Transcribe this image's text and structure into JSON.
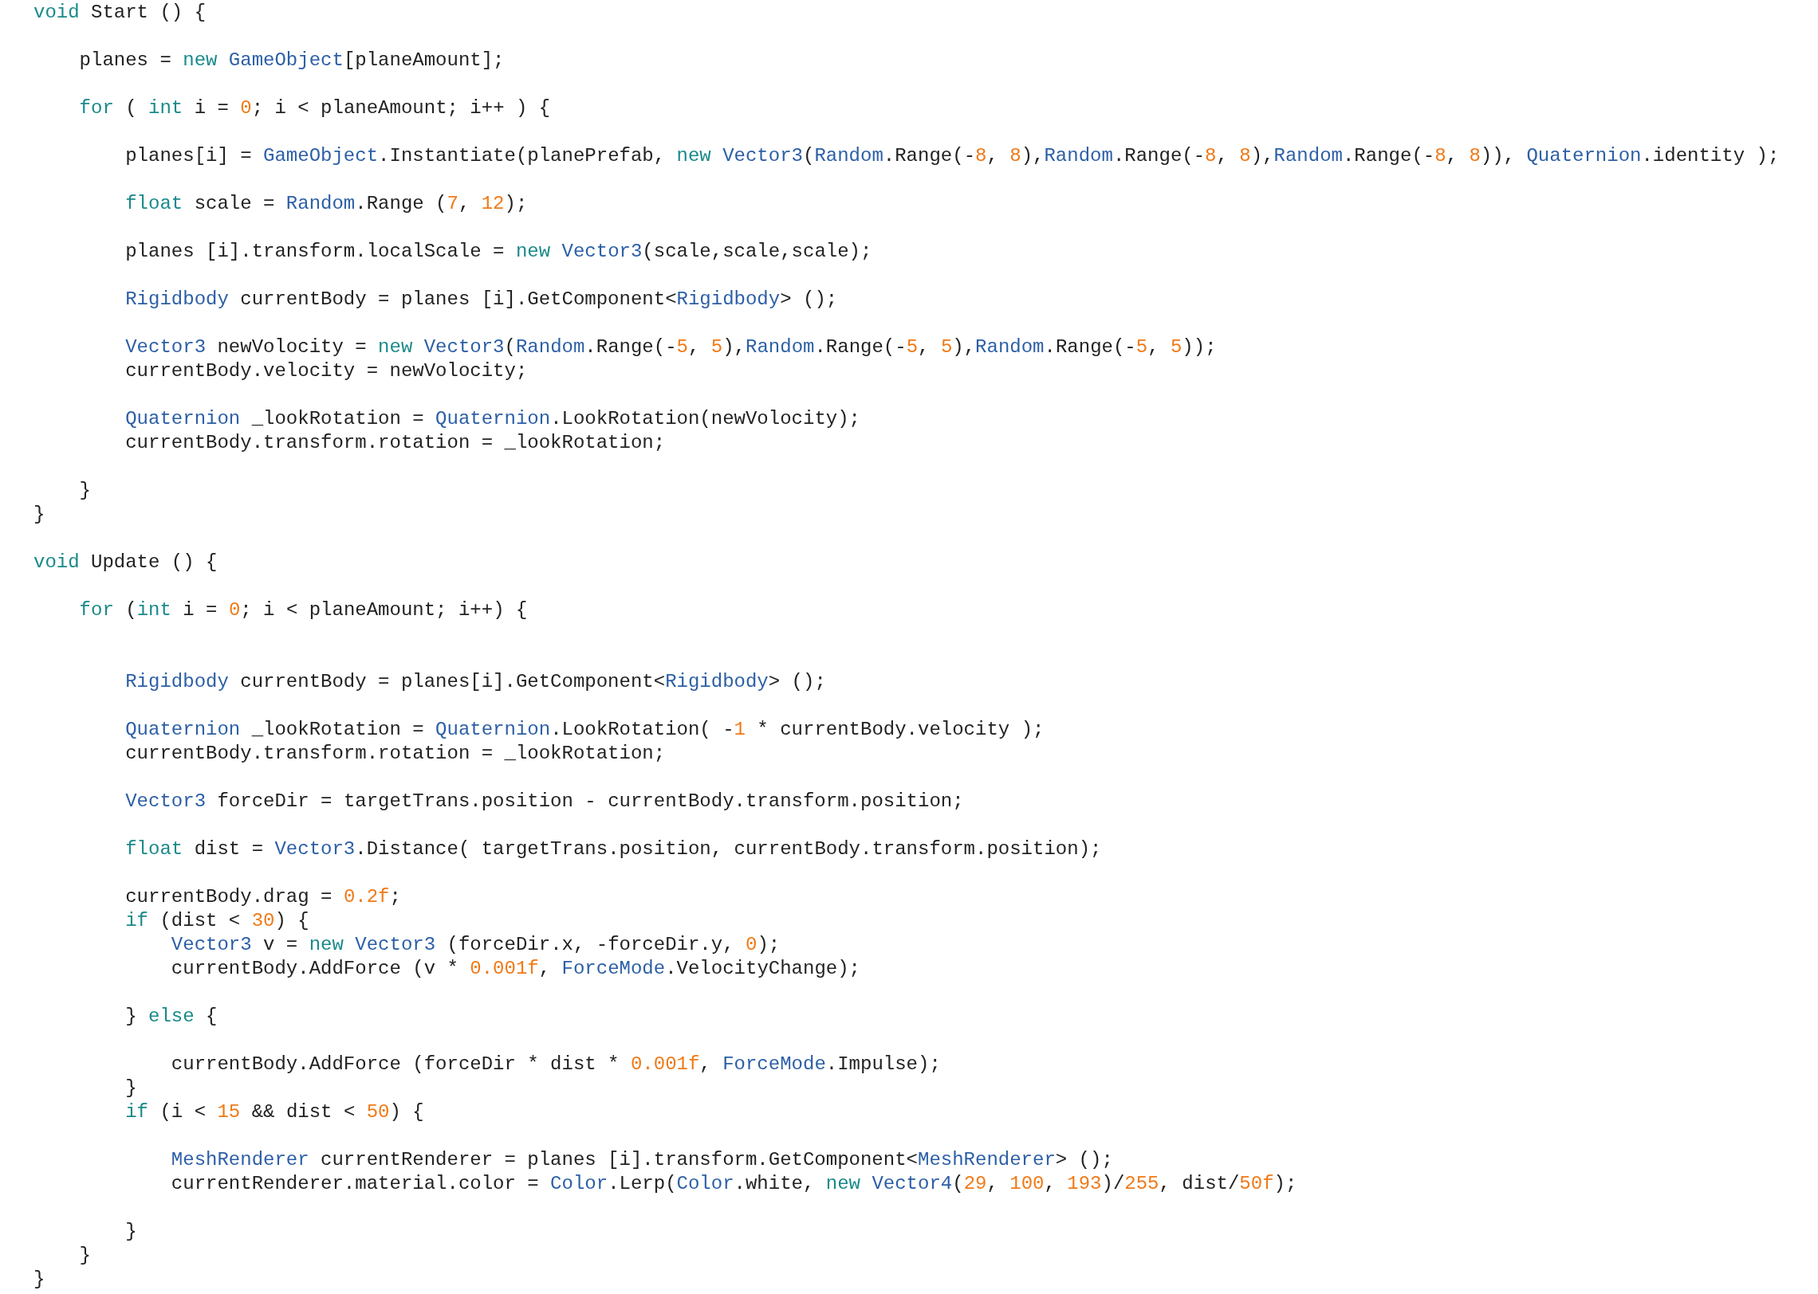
{
  "code_lines": [
    {
      "kind": "code",
      "tokens": [
        {
          "kind": "keyword",
          "text": "void"
        },
        {
          "kind": "plain",
          "text": " Start () {"
        }
      ]
    },
    {
      "kind": "blank"
    },
    {
      "kind": "code",
      "tokens": [
        {
          "kind": "plain",
          "text": "    planes = "
        },
        {
          "kind": "keyword",
          "text": "new "
        },
        {
          "kind": "type",
          "text": "GameObject"
        },
        {
          "kind": "plain",
          "text": "[planeAmount];"
        }
      ]
    },
    {
      "kind": "blank"
    },
    {
      "kind": "code",
      "tokens": [
        {
          "kind": "keyword",
          "text": "    for"
        },
        {
          "kind": "plain",
          "text": " ( "
        },
        {
          "kind": "keyword",
          "text": "int"
        },
        {
          "kind": "plain",
          "text": " i = "
        },
        {
          "kind": "number",
          "text": "0"
        },
        {
          "kind": "plain",
          "text": "; i < planeAmount; i++ ) {"
        }
      ]
    },
    {
      "kind": "blank"
    },
    {
      "kind": "code",
      "tokens": [
        {
          "kind": "plain",
          "text": "        planes[i] = "
        },
        {
          "kind": "type",
          "text": "GameObject"
        },
        {
          "kind": "plain",
          "text": ".Instantiate(planePrefab, "
        },
        {
          "kind": "keyword",
          "text": "new "
        },
        {
          "kind": "type",
          "text": "Vector3"
        },
        {
          "kind": "plain",
          "text": "("
        },
        {
          "kind": "type",
          "text": "Random"
        },
        {
          "kind": "plain",
          "text": ".Range(-"
        },
        {
          "kind": "number",
          "text": "8"
        },
        {
          "kind": "plain",
          "text": ", "
        },
        {
          "kind": "number",
          "text": "8"
        },
        {
          "kind": "plain",
          "text": "),"
        },
        {
          "kind": "type",
          "text": "Random"
        },
        {
          "kind": "plain",
          "text": ".Range(-"
        },
        {
          "kind": "number",
          "text": "8"
        },
        {
          "kind": "plain",
          "text": ", "
        },
        {
          "kind": "number",
          "text": "8"
        },
        {
          "kind": "plain",
          "text": "),"
        },
        {
          "kind": "type",
          "text": "Random"
        },
        {
          "kind": "plain",
          "text": ".Range(-"
        },
        {
          "kind": "number",
          "text": "8"
        },
        {
          "kind": "plain",
          "text": ", "
        },
        {
          "kind": "number",
          "text": "8"
        },
        {
          "kind": "plain",
          "text": ")), "
        },
        {
          "kind": "type",
          "text": "Quaternion"
        },
        {
          "kind": "plain",
          "text": ".identity );"
        }
      ]
    },
    {
      "kind": "blank"
    },
    {
      "kind": "code",
      "tokens": [
        {
          "kind": "keyword",
          "text": "        float"
        },
        {
          "kind": "plain",
          "text": " scale = "
        },
        {
          "kind": "type",
          "text": "Random"
        },
        {
          "kind": "plain",
          "text": ".Range ("
        },
        {
          "kind": "number",
          "text": "7"
        },
        {
          "kind": "plain",
          "text": ", "
        },
        {
          "kind": "number",
          "text": "12"
        },
        {
          "kind": "plain",
          "text": ");"
        }
      ]
    },
    {
      "kind": "blank"
    },
    {
      "kind": "code",
      "tokens": [
        {
          "kind": "plain",
          "text": "        planes [i].transform.localScale = "
        },
        {
          "kind": "keyword",
          "text": "new "
        },
        {
          "kind": "type",
          "text": "Vector3"
        },
        {
          "kind": "plain",
          "text": "(scale,scale,scale);"
        }
      ]
    },
    {
      "kind": "blank"
    },
    {
      "kind": "code",
      "tokens": [
        {
          "kind": "type",
          "text": "        Rigidbody"
        },
        {
          "kind": "plain",
          "text": " currentBody = planes [i].GetComponent<"
        },
        {
          "kind": "type",
          "text": "Rigidbody"
        },
        {
          "kind": "plain",
          "text": "> ();"
        }
      ]
    },
    {
      "kind": "blank"
    },
    {
      "kind": "code",
      "tokens": [
        {
          "kind": "type",
          "text": "        Vector3"
        },
        {
          "kind": "plain",
          "text": " newVolocity = "
        },
        {
          "kind": "keyword",
          "text": "new "
        },
        {
          "kind": "type",
          "text": "Vector3"
        },
        {
          "kind": "plain",
          "text": "("
        },
        {
          "kind": "type",
          "text": "Random"
        },
        {
          "kind": "plain",
          "text": ".Range(-"
        },
        {
          "kind": "number",
          "text": "5"
        },
        {
          "kind": "plain",
          "text": ", "
        },
        {
          "kind": "number",
          "text": "5"
        },
        {
          "kind": "plain",
          "text": "),"
        },
        {
          "kind": "type",
          "text": "Random"
        },
        {
          "kind": "plain",
          "text": ".Range(-"
        },
        {
          "kind": "number",
          "text": "5"
        },
        {
          "kind": "plain",
          "text": ", "
        },
        {
          "kind": "number",
          "text": "5"
        },
        {
          "kind": "plain",
          "text": "),"
        },
        {
          "kind": "type",
          "text": "Random"
        },
        {
          "kind": "plain",
          "text": ".Range(-"
        },
        {
          "kind": "number",
          "text": "5"
        },
        {
          "kind": "plain",
          "text": ", "
        },
        {
          "kind": "number",
          "text": "5"
        },
        {
          "kind": "plain",
          "text": "));"
        }
      ]
    },
    {
      "kind": "code",
      "tokens": [
        {
          "kind": "plain",
          "text": "        currentBody.velocity = newVolocity;"
        }
      ]
    },
    {
      "kind": "blank"
    },
    {
      "kind": "code",
      "tokens": [
        {
          "kind": "type",
          "text": "        Quaternion"
        },
        {
          "kind": "plain",
          "text": " _lookRotation = "
        },
        {
          "kind": "type",
          "text": "Quaternion"
        },
        {
          "kind": "plain",
          "text": ".LookRotation(newVolocity);"
        }
      ]
    },
    {
      "kind": "code",
      "tokens": [
        {
          "kind": "plain",
          "text": "        currentBody.transform.rotation = _lookRotation;"
        }
      ]
    },
    {
      "kind": "blank"
    },
    {
      "kind": "code",
      "tokens": [
        {
          "kind": "plain",
          "text": "    }"
        }
      ]
    },
    {
      "kind": "code",
      "tokens": [
        {
          "kind": "plain",
          "text": "}"
        }
      ]
    },
    {
      "kind": "blank"
    },
    {
      "kind": "code",
      "tokens": [
        {
          "kind": "keyword",
          "text": "void"
        },
        {
          "kind": "plain",
          "text": " Update () {"
        }
      ]
    },
    {
      "kind": "blank"
    },
    {
      "kind": "code",
      "tokens": [
        {
          "kind": "keyword",
          "text": "    for"
        },
        {
          "kind": "plain",
          "text": " ("
        },
        {
          "kind": "keyword",
          "text": "int"
        },
        {
          "kind": "plain",
          "text": " i = "
        },
        {
          "kind": "number",
          "text": "0"
        },
        {
          "kind": "plain",
          "text": "; i < planeAmount; i++) {"
        }
      ]
    },
    {
      "kind": "blank"
    },
    {
      "kind": "blank"
    },
    {
      "kind": "code",
      "tokens": [
        {
          "kind": "type",
          "text": "        Rigidbody"
        },
        {
          "kind": "plain",
          "text": " currentBody = planes[i].GetComponent<"
        },
        {
          "kind": "type",
          "text": "Rigidbody"
        },
        {
          "kind": "plain",
          "text": "> ();"
        }
      ]
    },
    {
      "kind": "blank"
    },
    {
      "kind": "code",
      "tokens": [
        {
          "kind": "type",
          "text": "        Quaternion"
        },
        {
          "kind": "plain",
          "text": " _lookRotation = "
        },
        {
          "kind": "type",
          "text": "Quaternion"
        },
        {
          "kind": "plain",
          "text": ".LookRotation( -"
        },
        {
          "kind": "number",
          "text": "1"
        },
        {
          "kind": "plain",
          "text": " * currentBody.velocity );"
        }
      ]
    },
    {
      "kind": "code",
      "tokens": [
        {
          "kind": "plain",
          "text": "        currentBody.transform.rotation = _lookRotation;"
        }
      ]
    },
    {
      "kind": "blank"
    },
    {
      "kind": "code",
      "tokens": [
        {
          "kind": "type",
          "text": "        Vector3"
        },
        {
          "kind": "plain",
          "text": " forceDir = targetTrans.position - currentBody.transform.position;"
        }
      ]
    },
    {
      "kind": "blank"
    },
    {
      "kind": "code",
      "tokens": [
        {
          "kind": "keyword",
          "text": "        float"
        },
        {
          "kind": "plain",
          "text": " dist = "
        },
        {
          "kind": "type",
          "text": "Vector3"
        },
        {
          "kind": "plain",
          "text": ".Distance( targetTrans.position, currentBody.transform.position);"
        }
      ]
    },
    {
      "kind": "blank"
    },
    {
      "kind": "code",
      "tokens": [
        {
          "kind": "plain",
          "text": "        currentBody.drag = "
        },
        {
          "kind": "number",
          "text": "0.2f"
        },
        {
          "kind": "plain",
          "text": ";"
        }
      ]
    },
    {
      "kind": "code",
      "tokens": [
        {
          "kind": "keyword",
          "text": "        if"
        },
        {
          "kind": "plain",
          "text": " (dist < "
        },
        {
          "kind": "number",
          "text": "30"
        },
        {
          "kind": "plain",
          "text": ") {"
        }
      ]
    },
    {
      "kind": "code",
      "tokens": [
        {
          "kind": "type",
          "text": "            Vector3"
        },
        {
          "kind": "plain",
          "text": " v = "
        },
        {
          "kind": "keyword",
          "text": "new "
        },
        {
          "kind": "type",
          "text": "Vector3"
        },
        {
          "kind": "plain",
          "text": " (forceDir.x, -forceDir.y, "
        },
        {
          "kind": "number",
          "text": "0"
        },
        {
          "kind": "plain",
          "text": ");"
        }
      ]
    },
    {
      "kind": "code",
      "tokens": [
        {
          "kind": "plain",
          "text": "            currentBody.AddForce (v * "
        },
        {
          "kind": "number",
          "text": "0.001f"
        },
        {
          "kind": "plain",
          "text": ", "
        },
        {
          "kind": "type",
          "text": "ForceMode"
        },
        {
          "kind": "plain",
          "text": ".VelocityChange);"
        }
      ]
    },
    {
      "kind": "blank"
    },
    {
      "kind": "code",
      "tokens": [
        {
          "kind": "plain",
          "text": "        } "
        },
        {
          "kind": "keyword",
          "text": "else"
        },
        {
          "kind": "plain",
          "text": " {"
        }
      ]
    },
    {
      "kind": "blank"
    },
    {
      "kind": "code",
      "tokens": [
        {
          "kind": "plain",
          "text": "            currentBody.AddForce (forceDir * dist * "
        },
        {
          "kind": "number",
          "text": "0.001f"
        },
        {
          "kind": "plain",
          "text": ", "
        },
        {
          "kind": "type",
          "text": "ForceMode"
        },
        {
          "kind": "plain",
          "text": ".Impulse);"
        }
      ]
    },
    {
      "kind": "code",
      "tokens": [
        {
          "kind": "plain",
          "text": "        }"
        }
      ]
    },
    {
      "kind": "code",
      "tokens": [
        {
          "kind": "keyword",
          "text": "        if"
        },
        {
          "kind": "plain",
          "text": " (i < "
        },
        {
          "kind": "number",
          "text": "15"
        },
        {
          "kind": "plain",
          "text": " && dist < "
        },
        {
          "kind": "number",
          "text": "50"
        },
        {
          "kind": "plain",
          "text": ") {"
        }
      ]
    },
    {
      "kind": "blank"
    },
    {
      "kind": "code",
      "tokens": [
        {
          "kind": "type",
          "text": "            MeshRenderer"
        },
        {
          "kind": "plain",
          "text": " currentRenderer = planes [i].transform.GetComponent<"
        },
        {
          "kind": "type",
          "text": "MeshRenderer"
        },
        {
          "kind": "plain",
          "text": "> ();"
        }
      ]
    },
    {
      "kind": "code",
      "tokens": [
        {
          "kind": "plain",
          "text": "            currentRenderer.material.color = "
        },
        {
          "kind": "type",
          "text": "Color"
        },
        {
          "kind": "plain",
          "text": ".Lerp("
        },
        {
          "kind": "type",
          "text": "Color"
        },
        {
          "kind": "plain",
          "text": ".white, "
        },
        {
          "kind": "keyword",
          "text": "new "
        },
        {
          "kind": "type",
          "text": "Vector4"
        },
        {
          "kind": "plain",
          "text": "("
        },
        {
          "kind": "number",
          "text": "29"
        },
        {
          "kind": "plain",
          "text": ", "
        },
        {
          "kind": "number",
          "text": "100"
        },
        {
          "kind": "plain",
          "text": ", "
        },
        {
          "kind": "number",
          "text": "193"
        },
        {
          "kind": "plain",
          "text": ")/"
        },
        {
          "kind": "number",
          "text": "255"
        },
        {
          "kind": "plain",
          "text": ", dist/"
        },
        {
          "kind": "number",
          "text": "50f"
        },
        {
          "kind": "plain",
          "text": ");"
        }
      ]
    },
    {
      "kind": "blank"
    },
    {
      "kind": "code",
      "tokens": [
        {
          "kind": "plain",
          "text": "        }"
        }
      ]
    },
    {
      "kind": "code",
      "tokens": [
        {
          "kind": "plain",
          "text": "    }"
        }
      ]
    },
    {
      "kind": "code",
      "tokens": [
        {
          "kind": "plain",
          "text": "}"
        }
      ]
    }
  ]
}
